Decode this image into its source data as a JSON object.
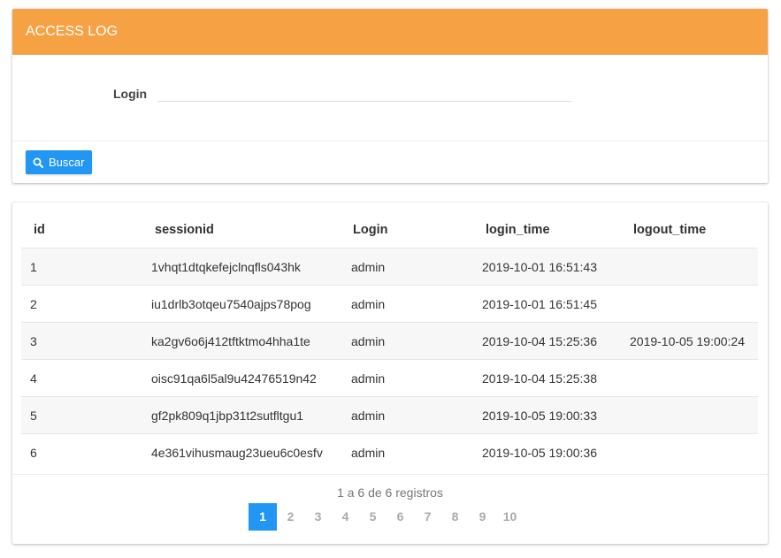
{
  "header": {
    "title": "ACCESS LOG",
    "color": "#f6a244"
  },
  "form": {
    "login_label": "Login",
    "login_value": ""
  },
  "actions": {
    "search_label": "Buscar",
    "search_icon": "search-icon",
    "accent": "#2196f3"
  },
  "table": {
    "columns": [
      "id",
      "sessionid",
      "Login",
      "login_time",
      "logout_time"
    ],
    "rows": [
      [
        "1",
        "1vhqt1dtqkefejclnqfls043hk",
        "admin",
        "2019-10-01 16:51:43",
        ""
      ],
      [
        "2",
        "iu1drlb3otqeu7540ajps78pog",
        "admin",
        "2019-10-01 16:51:45",
        ""
      ],
      [
        "3",
        "ka2gv6o6j412tftktmo4hha1te",
        "admin",
        "2019-10-04 15:25:36",
        "2019-10-05 19:00:24"
      ],
      [
        "4",
        "oisc91qa6l5al9u42476519n42",
        "admin",
        "2019-10-04 15:25:38",
        ""
      ],
      [
        "5",
        "gf2pk809q1jbp31t2sutfltgu1",
        "admin",
        "2019-10-05 19:00:33",
        ""
      ],
      [
        "6",
        "4e361vihusmaug23ueu6c0esfv",
        "admin",
        "2019-10-05 19:00:36",
        ""
      ]
    ]
  },
  "pagination": {
    "info": "1 a 6 de 6 registros",
    "pages": [
      "1",
      "2",
      "3",
      "4",
      "5",
      "6",
      "7",
      "8",
      "9",
      "10"
    ],
    "current": "1"
  }
}
